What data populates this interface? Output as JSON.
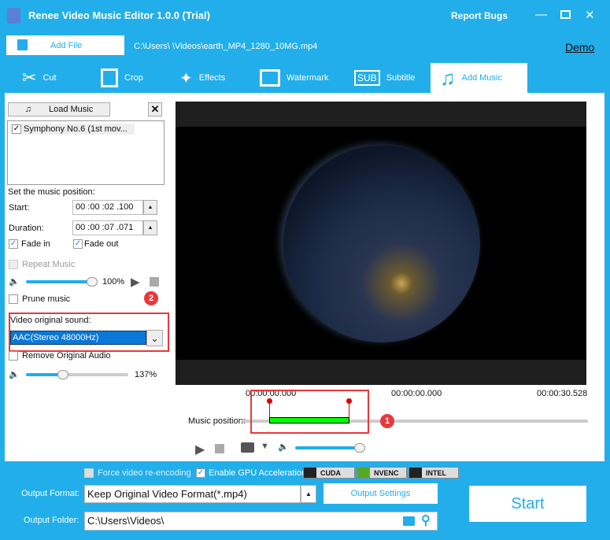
{
  "app": {
    "title": "Renee Video Music Editor 1.0.0 (Trial)",
    "report_bugs": "Report Bugs",
    "demo": "Demo"
  },
  "file": {
    "add_file": "Add File",
    "path": "C:\\Users\\      \\Videos\\earth_MP4_1280_10MG.mp4"
  },
  "tabs": [
    {
      "label": "Cut",
      "icon": "scissors-icon"
    },
    {
      "label": "Crop",
      "icon": "crop-icon"
    },
    {
      "label": "Effects",
      "icon": "magic-wand-icon"
    },
    {
      "label": "Watermark",
      "icon": "watermark-icon"
    },
    {
      "label": "Subtitle",
      "icon": "subtitle-icon"
    },
    {
      "label": "Add Music",
      "icon": "music-note-icon",
      "active": true
    }
  ],
  "music": {
    "load_music": "Load Music",
    "items": [
      {
        "label": "Symphony No.6 (1st mov...",
        "checked": true
      }
    ],
    "position_label": "Set the music position:",
    "start_label": "Start:",
    "start_value": "00 :00 :02 .100",
    "duration_label": "Duration:",
    "duration_value": "00 :00 :07 .071",
    "fade_in": "Fade in",
    "fade_out": "Fade out",
    "repeat": "Repeat Music",
    "volume": "100%",
    "volume_level": 100,
    "prune": "Prune music",
    "orig_sound_label": "Video original sound:",
    "orig_sound_value": "AAC(Stereo 48000Hz)",
    "remove_orig": "Remove Original Audio",
    "orig_volume": "137%",
    "orig_volume_level": 137
  },
  "badges": {
    "one": "1",
    "two": "2"
  },
  "timeline": {
    "start": "00:00:00.000",
    "current": "00:00:00.000",
    "end": "00:00:30.528",
    "music_position_label": "Music position:"
  },
  "bottom": {
    "force_reencode": "Force video re-encoding",
    "gpu": "Enable GPU Acceleration",
    "cuda": "CUDA",
    "nvenc": "NVENC",
    "intel": "INTEL",
    "output_format_label": "Output Format:",
    "output_format": "Keep Original Video Format(*.mp4)",
    "output_settings": "Output Settings",
    "output_folder_label": "Output Folder:",
    "output_folder": "C:\\Users\\Videos\\",
    "start": "Start"
  },
  "colors": {
    "accent": "#22aeea",
    "highlight": "#e8383b",
    "music_bar": "#00ff00"
  }
}
